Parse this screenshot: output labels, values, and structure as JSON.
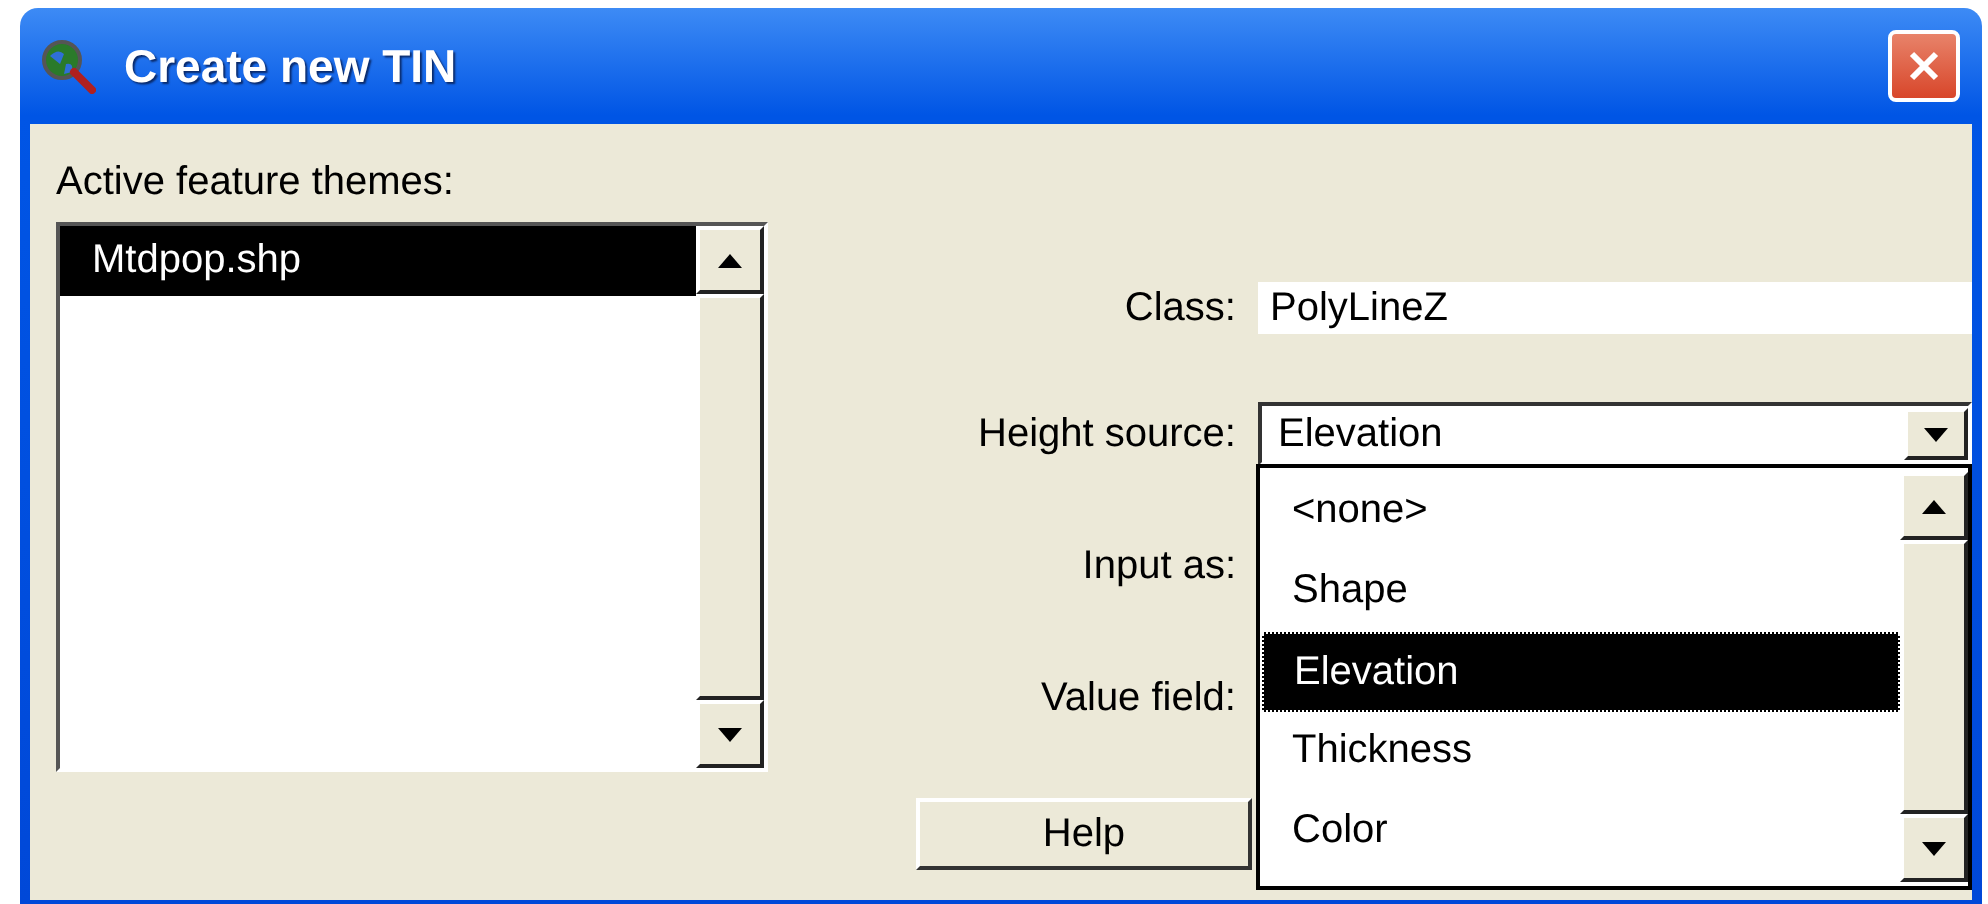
{
  "window": {
    "title": "Create new TIN"
  },
  "themes": {
    "label": "Active feature themes:",
    "items": [
      {
        "name": "Mtdpop.shp",
        "selected": true
      }
    ]
  },
  "class_field": {
    "label": "Class:",
    "value": "PolyLineZ"
  },
  "height_source": {
    "label": "Height source:",
    "value": "Elevation",
    "expanded": true,
    "options": [
      {
        "label": "<none>",
        "selected": false
      },
      {
        "label": "Shape",
        "selected": false
      },
      {
        "label": "Elevation",
        "selected": true
      },
      {
        "label": "Thickness",
        "selected": false
      },
      {
        "label": "Color",
        "selected": false
      }
    ]
  },
  "input_as": {
    "label": "Input as:"
  },
  "value_field": {
    "label": "Value field:"
  },
  "buttons": [
    {
      "label": "Help"
    }
  ]
}
